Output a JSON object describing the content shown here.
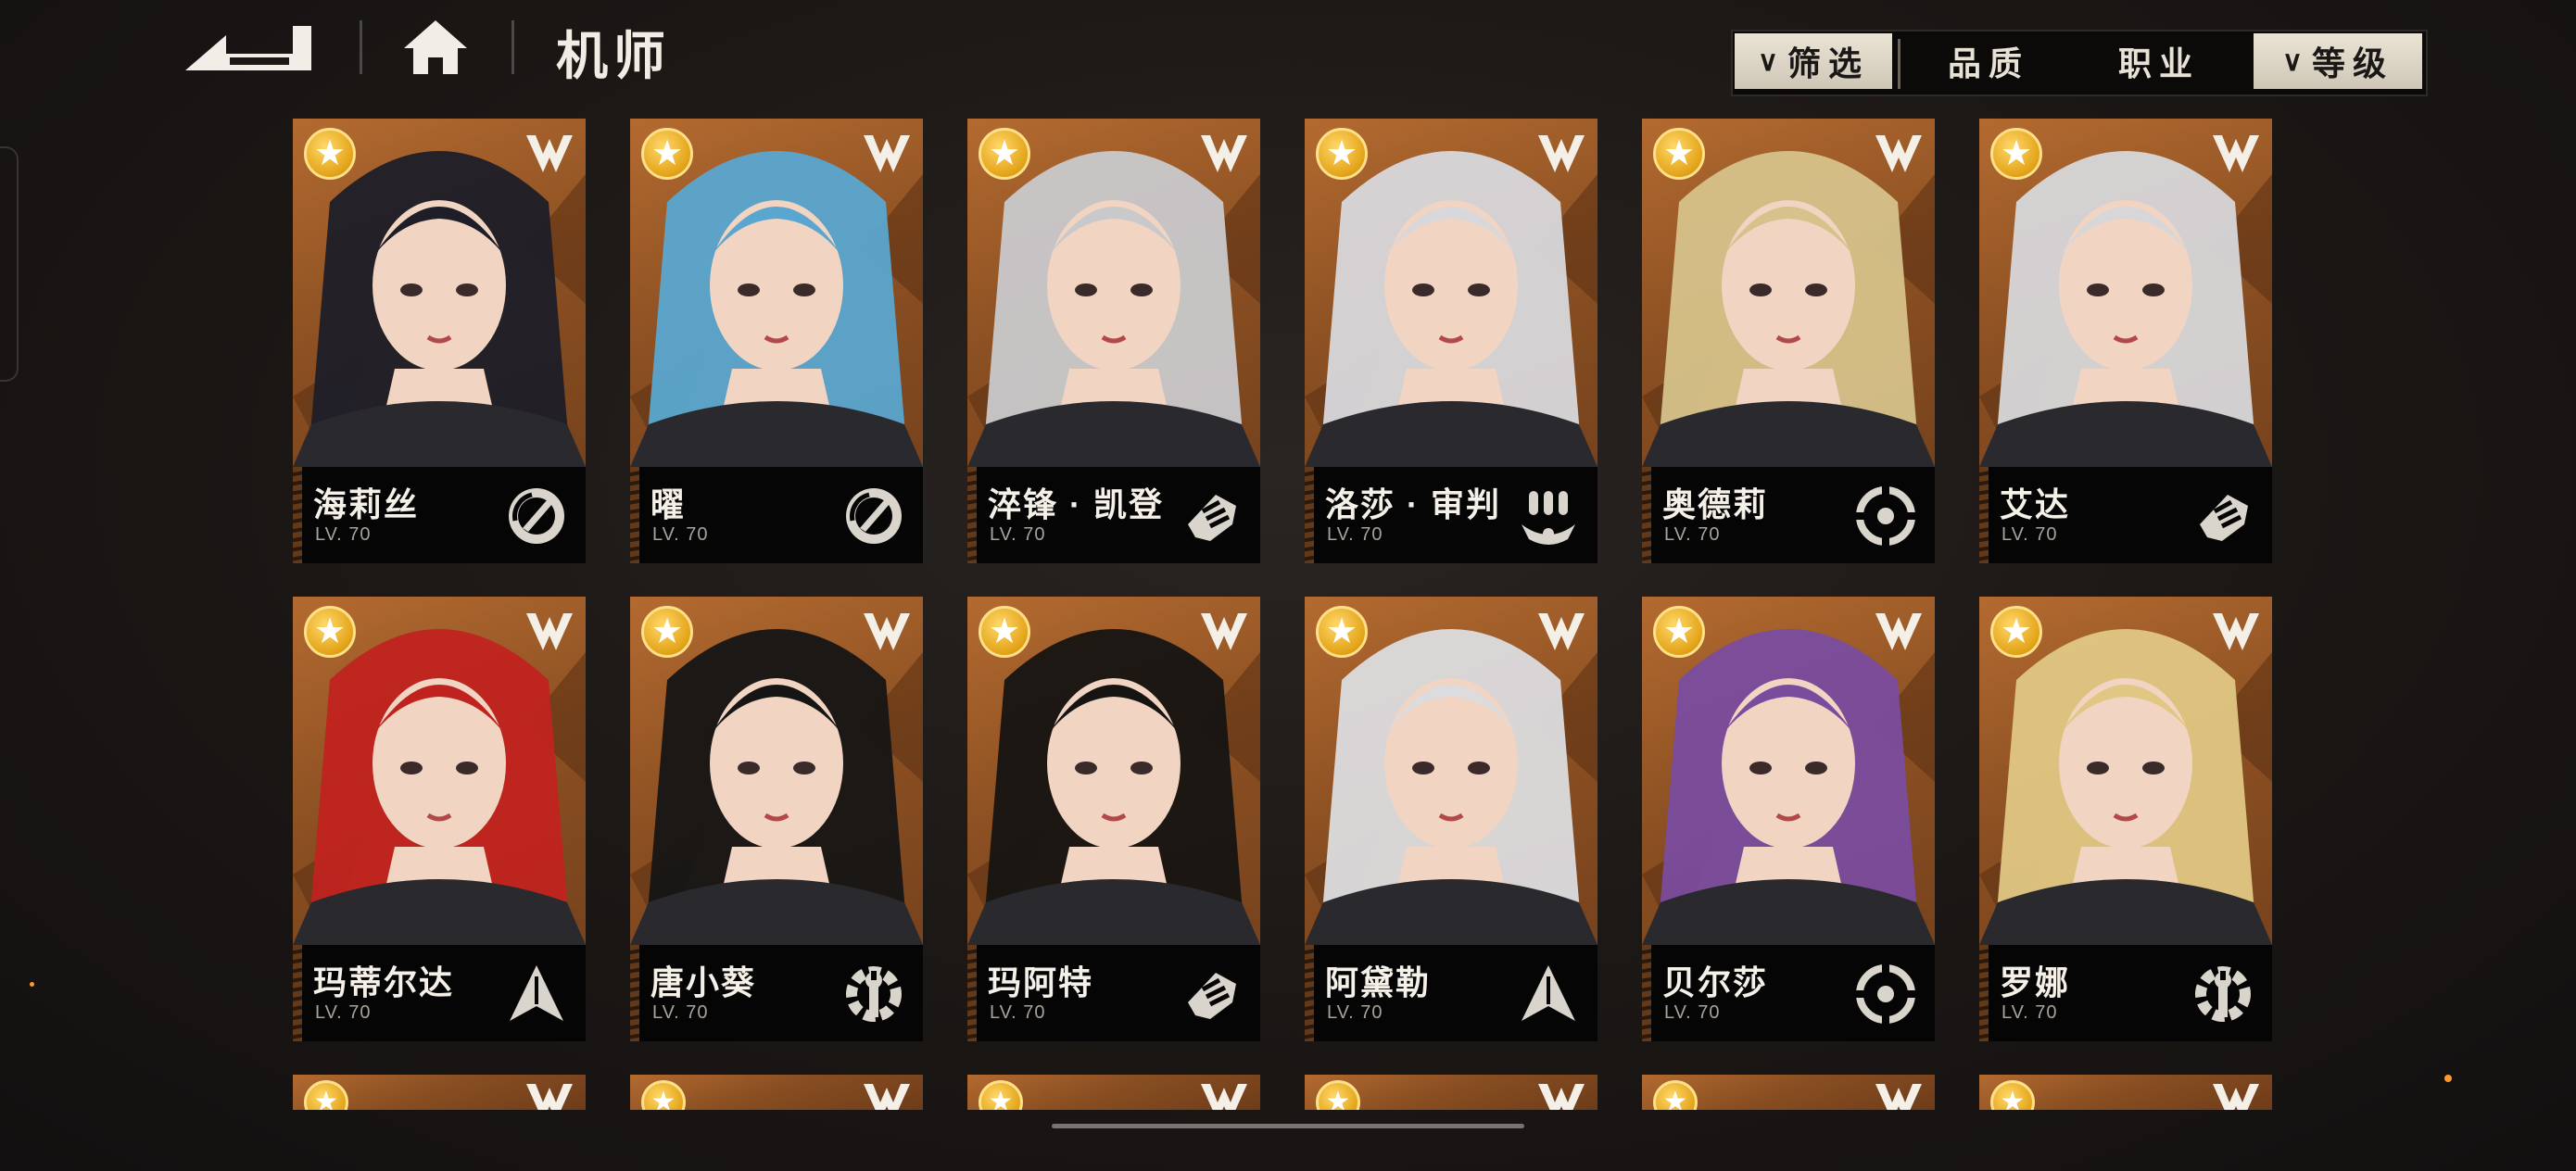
{
  "header": {
    "title": "机师"
  },
  "filters": {
    "filter_label": "筛选",
    "quality_label": "品质",
    "class_label": "职业",
    "level_label": "等级"
  },
  "colors": {
    "card_bg": "#9a5a28",
    "nameplate_bg": "#060505",
    "star_gold": "#e3a318",
    "filter_light": "#e2dccd"
  },
  "pilots": [
    {
      "name": "海莉丝",
      "level": "LV. 70",
      "class_icon": "gauge-icon",
      "hair": "#1d1e28"
    },
    {
      "name": "曜",
      "level": "LV. 70",
      "class_icon": "gauge-icon",
      "hair": "#5aa6d0"
    },
    {
      "name": "淬锋 · 凯登",
      "level": "LV. 70",
      "class_icon": "fist-icon",
      "hair": "#c9c9cc"
    },
    {
      "name": "洛莎 · 审判",
      "level": "LV. 70",
      "class_icon": "missiles-icon",
      "hair": "#d8d8dc"
    },
    {
      "name": "奥德莉",
      "level": "LV. 70",
      "class_icon": "crosshair-icon",
      "hair": "#d6c28a"
    },
    {
      "name": "艾达",
      "level": "LV. 70",
      "class_icon": "fist-icon",
      "hair": "#d7d7da"
    },
    {
      "name": "玛蒂尔达",
      "level": "LV. 70",
      "class_icon": "arrowhead-icon",
      "hair": "#c0231f"
    },
    {
      "name": "唐小葵",
      "level": "LV. 70",
      "class_icon": "wrench-gear-icon",
      "hair": "#151515"
    },
    {
      "name": "玛阿特",
      "level": "LV. 70",
      "class_icon": "fist-icon",
      "hair": "#161412"
    },
    {
      "name": "阿黛勒",
      "level": "LV. 70",
      "class_icon": "arrowhead-icon",
      "hair": "#dcdcdf"
    },
    {
      "name": "贝尔莎",
      "level": "LV. 70",
      "class_icon": "crosshair-icon",
      "hair": "#7a4c9e"
    },
    {
      "name": "罗娜",
      "level": "LV. 70",
      "class_icon": "wrench-gear-icon",
      "hair": "#e0c784"
    }
  ]
}
